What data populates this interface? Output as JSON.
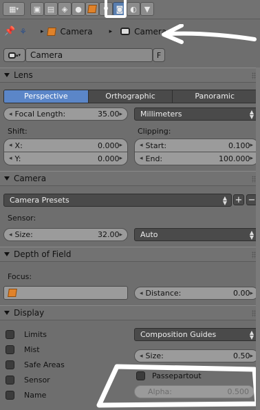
{
  "tabs": [
    "render-icon",
    "layers-icon",
    "scene-icon",
    "world-icon",
    "object-icon",
    "constraints-icon",
    "camera-data-icon",
    "material-icon",
    "texture-icon"
  ],
  "breadcrumb": {
    "object": "Camera",
    "data": "Camera"
  },
  "datablock": {
    "name": "Camera",
    "fake_user": "F"
  },
  "lens": {
    "title": "Lens",
    "types": [
      "Perspective",
      "Orthographic",
      "Panoramic"
    ],
    "active_type": "Perspective",
    "focal_label": "Focal Length:",
    "focal_value": "35.00",
    "focal_unit": "Millimeters",
    "shift_label": "Shift:",
    "shift_x_label": "X:",
    "shift_x": "0.000",
    "shift_y_label": "Y:",
    "shift_y": "0.000",
    "clip_label": "Clipping:",
    "clip_start_label": "Start:",
    "clip_start": "0.100",
    "clip_end_label": "End:",
    "clip_end": "100.000"
  },
  "camera": {
    "title": "Camera",
    "presets": "Camera Presets",
    "sensor_label": "Sensor:",
    "size_label": "Size:",
    "size_value": "32.00",
    "fit": "Auto"
  },
  "dof": {
    "title": "Depth of Field",
    "focus_label": "Focus:",
    "distance_label": "Distance:",
    "distance_value": "0.00"
  },
  "display": {
    "title": "Display",
    "checkboxes": [
      "Limits",
      "Mist",
      "Safe Areas",
      "Sensor",
      "Name"
    ],
    "guides": "Composition Guides",
    "size_label": "Size:",
    "size_value": "0.50",
    "passepartout": "Passepartout",
    "alpha_label": "Alpha:",
    "alpha_value": "0.500"
  },
  "colors": {
    "accent": "#5b86c8",
    "panel": "#727272",
    "bg": "#6e6e6e"
  }
}
